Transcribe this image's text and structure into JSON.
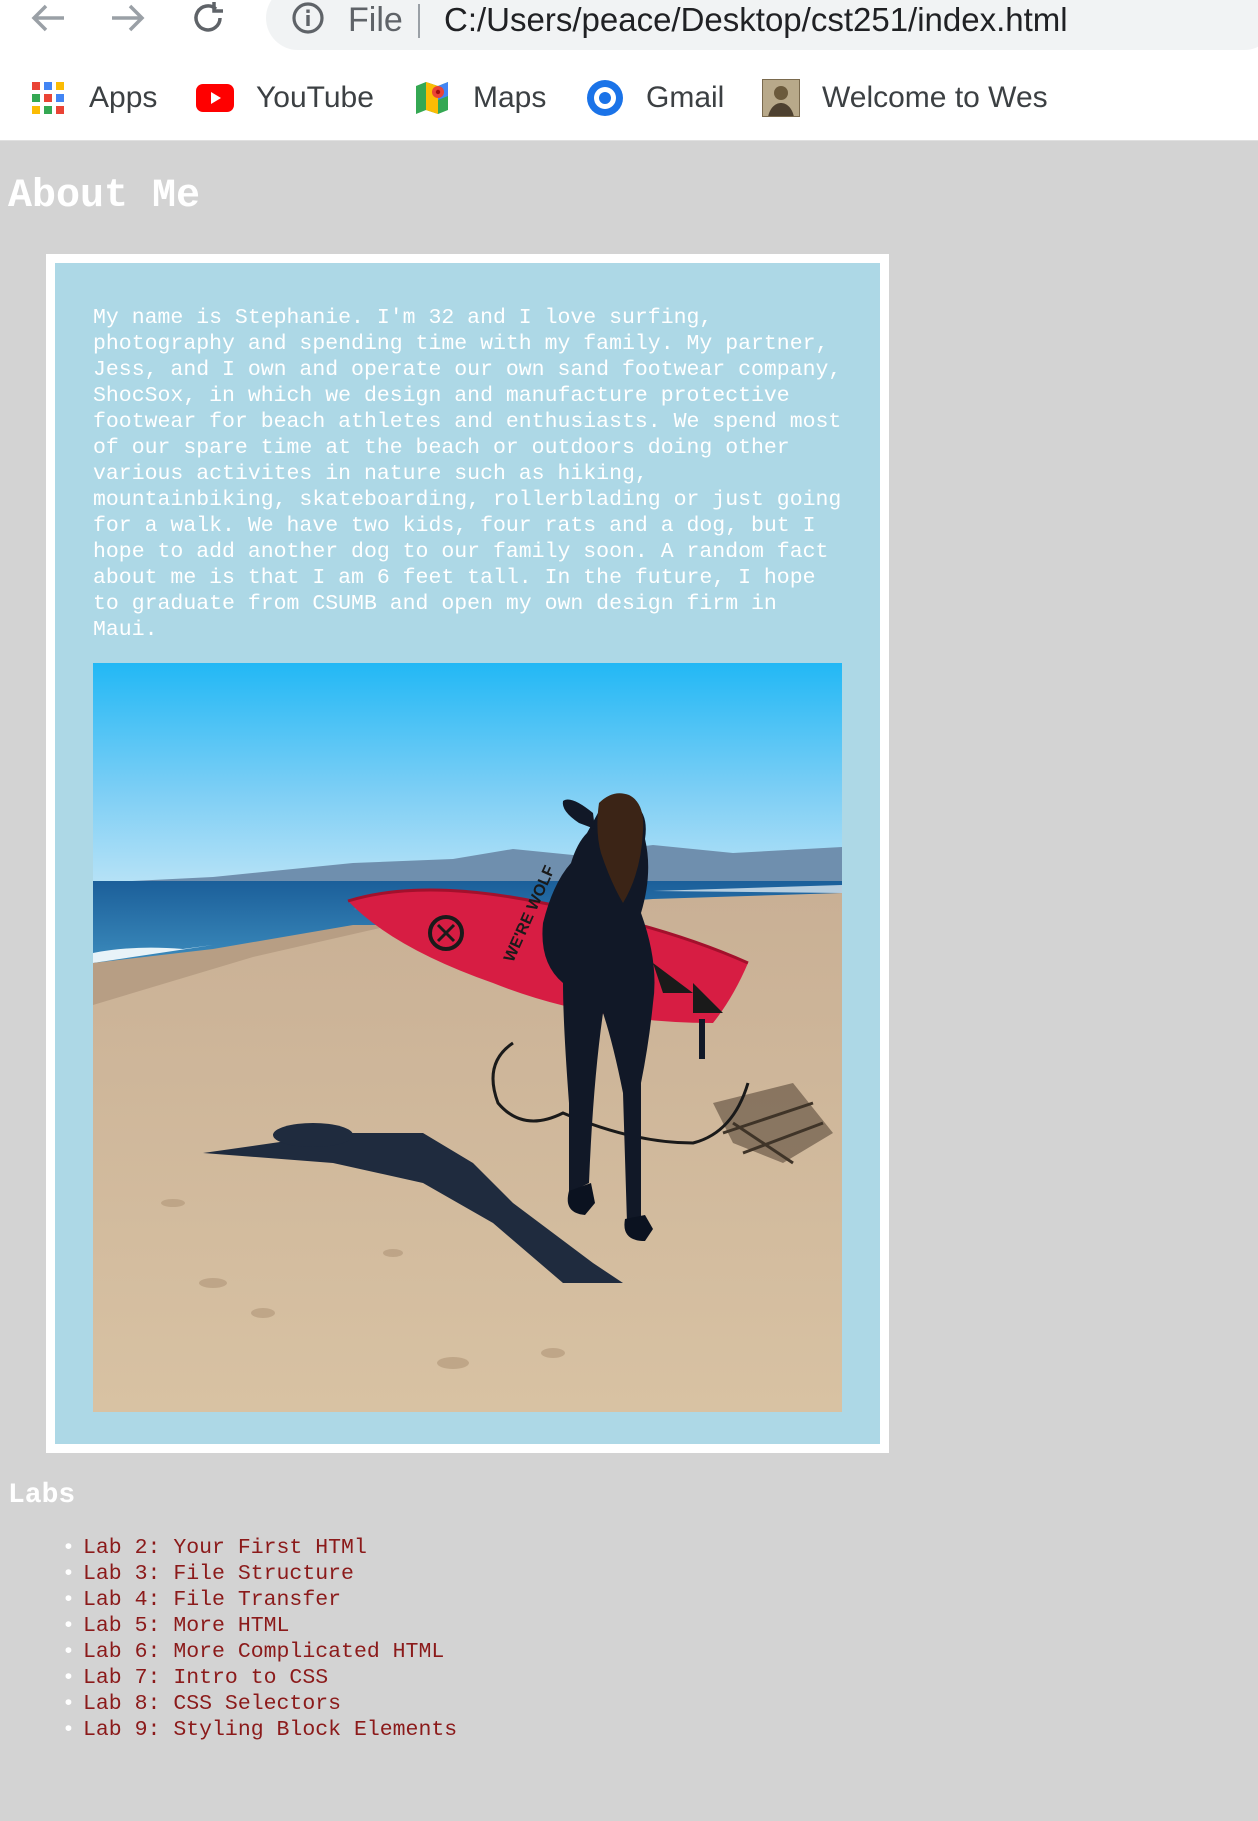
{
  "browser": {
    "scheme_label": "File",
    "url": "C:/Users/peace/Desktop/cst251/index.html",
    "bookmarks": [
      {
        "label": "Apps",
        "icon": "apps-grid-icon"
      },
      {
        "label": "YouTube",
        "icon": "youtube-icon"
      },
      {
        "label": "Maps",
        "icon": "maps-icon"
      },
      {
        "label": "Gmail",
        "icon": "gmail-icon"
      },
      {
        "label": "Welcome to Wes",
        "icon": "site-favicon-icon"
      }
    ]
  },
  "page": {
    "heading": "About Me",
    "bio": "My name is Stephanie. I'm 32 and I love surfing, photography and spending time with my family. My partner, Jess, and I own and operate our own sand footwear company, ShocSox, in which we design and manufacture protective footwear for beach athletes and enthusiasts. We spend most of our spare time at the beach or outdoors doing other various activites in nature such as hiking, mountainbiking, skateboarding, rollerblading or just going for a walk. We have two kids, four rats and a dog, but I hope to add another dog to our family soon. A random fact about me is that I am 6 feet tall. In the future, I hope to graduate from CSUMB and open my own design firm in Maui.",
    "photo_subject": "surfer-on-beach-photo",
    "surfboard_text": "WE'RE WOLF",
    "labs_heading": "Labs",
    "labs": [
      "Lab 2: Your First HTMl",
      "Lab 3: File Structure",
      "Lab 4: File Transfer",
      "Lab 5: More HTML",
      "Lab 6: More Complicated HTML",
      "Lab 7: Intro to CSS",
      "Lab 8: CSS Selectors",
      "Lab 9: Styling Block Elements"
    ]
  },
  "colors": {
    "page_bg": "#d3d3d3",
    "card_bg": "#add8e6",
    "card_border": "#ffffff",
    "text_light": "#ffffff",
    "link": "#8b1a1a"
  }
}
